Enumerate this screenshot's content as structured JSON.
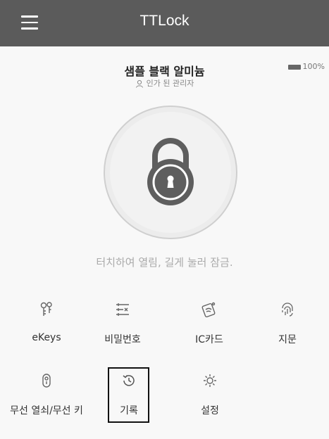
{
  "app_bar": {
    "title": "TTLock"
  },
  "lock": {
    "name": "샘플 블랙 알미늄",
    "role": "인가 된 관리자",
    "battery": "100%",
    "hint": "터치하여 열림, 길게 눌러 잠금."
  },
  "functions": [
    {
      "label": "eKeys",
      "icon": "ekeys-icon"
    },
    {
      "label": "비밀번호",
      "icon": "passcode-icon"
    },
    {
      "label": "IC카드",
      "icon": "ic-card-icon"
    },
    {
      "label": "지문",
      "icon": "fingerprint-icon"
    },
    {
      "label": "무선 열쇠/무선 키",
      "icon": "wireless-key-icon"
    },
    {
      "label": "기록",
      "icon": "records-icon"
    },
    {
      "label": "설정",
      "icon": "settings-icon"
    }
  ],
  "colors": {
    "app_bar": "#5b5b5b",
    "lock_body": "#5e5e5e",
    "icon": "#666666"
  }
}
